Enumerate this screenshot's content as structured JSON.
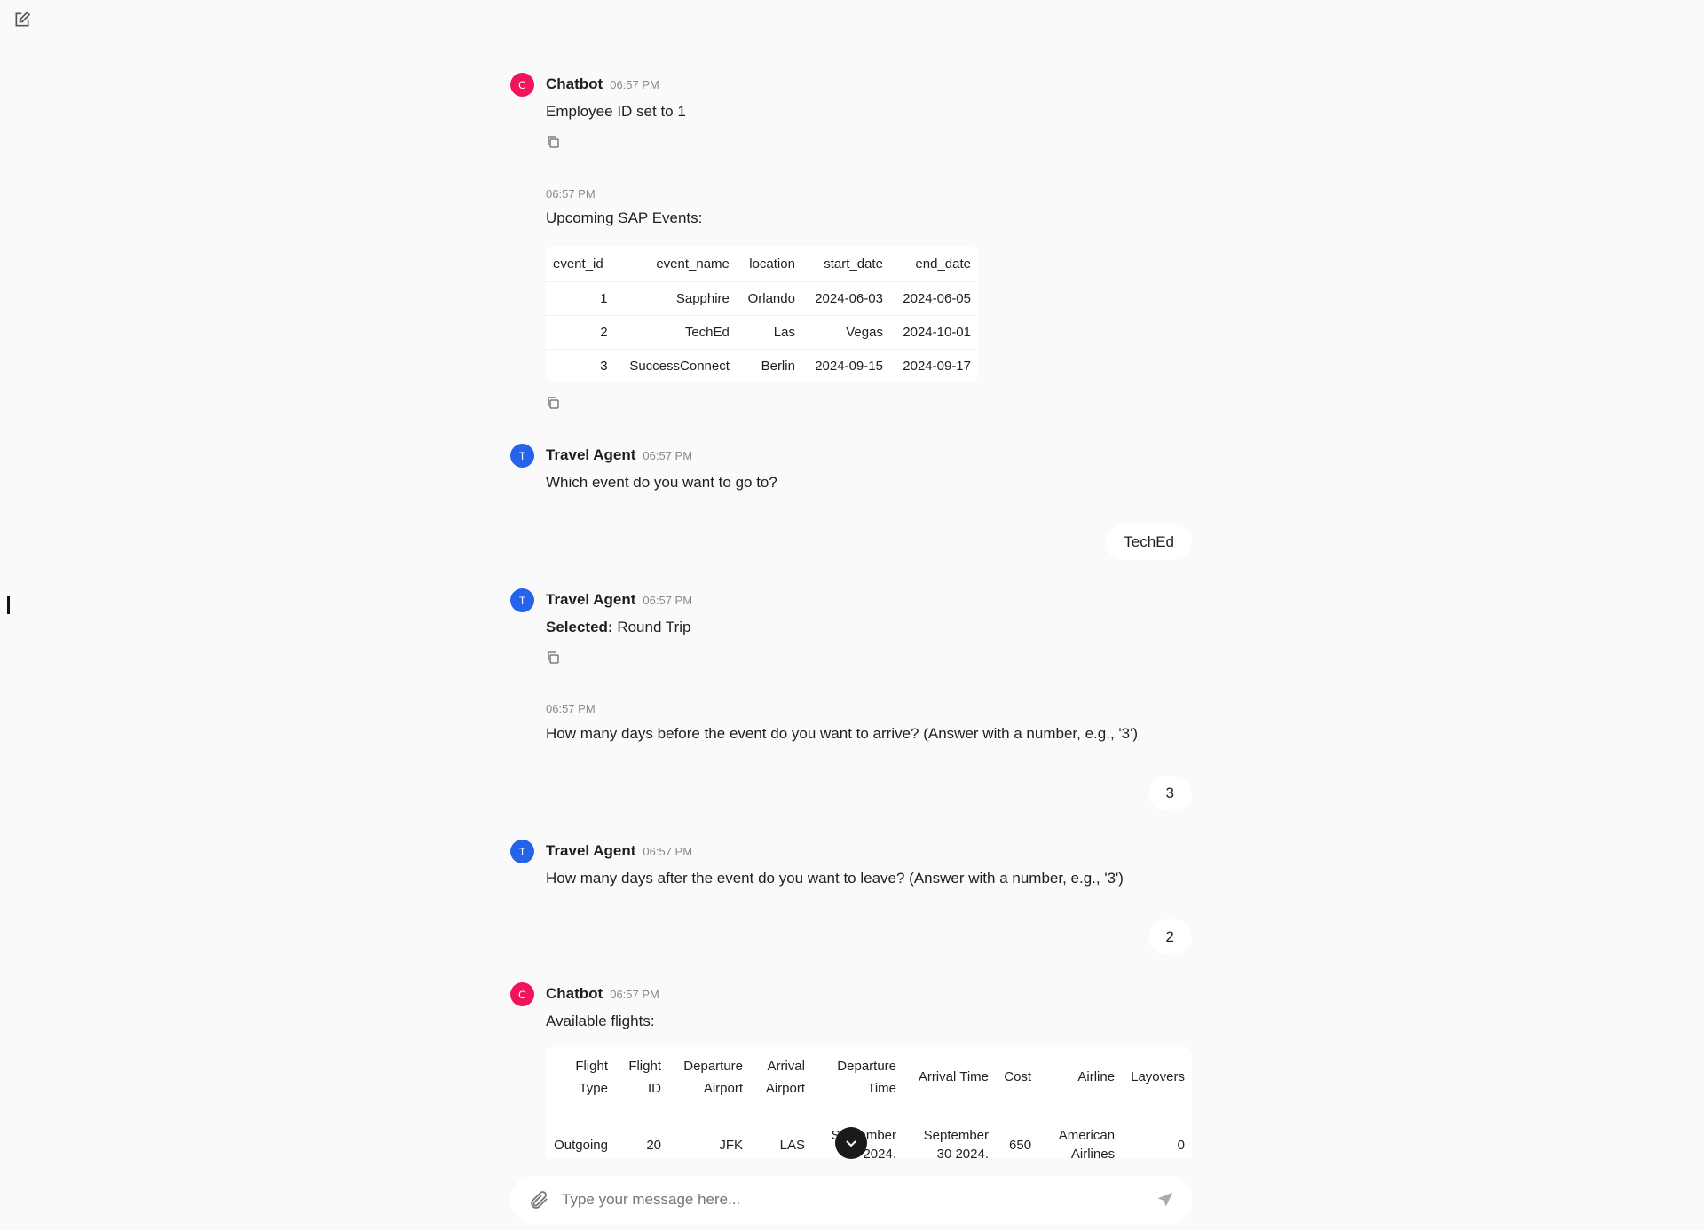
{
  "colors": {
    "chatbot_avatar": "#f0145a",
    "agent_avatar": "#2563eb",
    "background": "#fafafa"
  },
  "toolbar": {
    "new_chat_icon": "edit-icon"
  },
  "messages": [
    {
      "sender": "Chatbot",
      "initial": "C",
      "time": "06:57 PM",
      "text": "Employee ID set to 1"
    },
    {
      "time": "06:57 PM",
      "text": "Upcoming SAP Events:"
    },
    {
      "sender": "Travel Agent",
      "initial": "T",
      "time": "06:57 PM",
      "text": "Which event do you want to go to?"
    },
    {
      "user": "TechEd"
    },
    {
      "sender": "Travel Agent",
      "initial": "T",
      "time": "06:57 PM",
      "bold": "Selected:",
      "text": " Round Trip"
    },
    {
      "time": "06:57 PM",
      "text": "How many days before the event do you want to arrive? (Answer with a number, e.g., '3')"
    },
    {
      "user": "3"
    },
    {
      "sender": "Travel Agent",
      "initial": "T",
      "time": "06:57 PM",
      "text": "How many days after the event do you want to leave? (Answer with a number, e.g., '3')"
    },
    {
      "user": "2"
    },
    {
      "sender": "Chatbot",
      "initial": "C",
      "time": "06:57 PM",
      "text": "Available flights:"
    }
  ],
  "events_table": {
    "headers": [
      "event_id",
      "event_name",
      "location",
      "start_date",
      "end_date"
    ],
    "rows": [
      [
        "1",
        "Sapphire",
        "Orlando",
        "2024-06-03",
        "2024-06-05"
      ],
      [
        "2",
        "TechEd",
        "Las",
        "Vegas",
        "2024-10-01"
      ],
      [
        "3",
        "SuccessConnect",
        "Berlin",
        "2024-09-15",
        "2024-09-17"
      ]
    ]
  },
  "flights_table": {
    "headers": [
      "Flight Type",
      "Flight ID",
      "Departure Airport",
      "Arrival Airport",
      "Departure Time",
      "Arrival Time",
      "Cost",
      "Airline",
      "Layovers"
    ],
    "rows": [
      [
        "Outgoing",
        "20",
        "JFK",
        "LAS",
        "September 2024,",
        "September 30 2024,",
        "650",
        "American Airlines",
        "0"
      ]
    ]
  },
  "input": {
    "placeholder": "Type your message here..."
  }
}
